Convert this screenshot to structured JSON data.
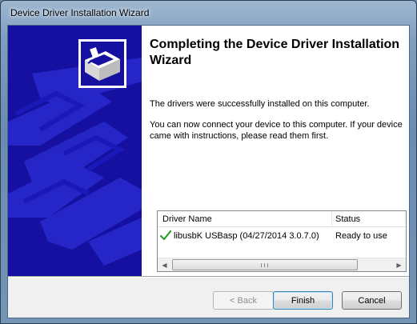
{
  "window": {
    "title": "Device Driver Installation Wizard"
  },
  "wizard": {
    "heading": "Completing the Device Driver Installation Wizard",
    "paragraph1": "The drivers were successfully installed on this computer.",
    "paragraph2": "You can now connect your device to this computer. If your device came with instructions, please read them first."
  },
  "driver_list": {
    "columns": [
      "Driver Name",
      "Status"
    ],
    "rows": [
      {
        "icon": "green-check-icon",
        "name": "libusbK USBasp (04/27/2014 3.0.7.0)",
        "status": "Ready to use"
      }
    ]
  },
  "buttons": {
    "back": "< Back",
    "finish": "Finish",
    "cancel": "Cancel"
  },
  "colors": {
    "banner": "#15109f",
    "check": "#2a9d2a"
  }
}
